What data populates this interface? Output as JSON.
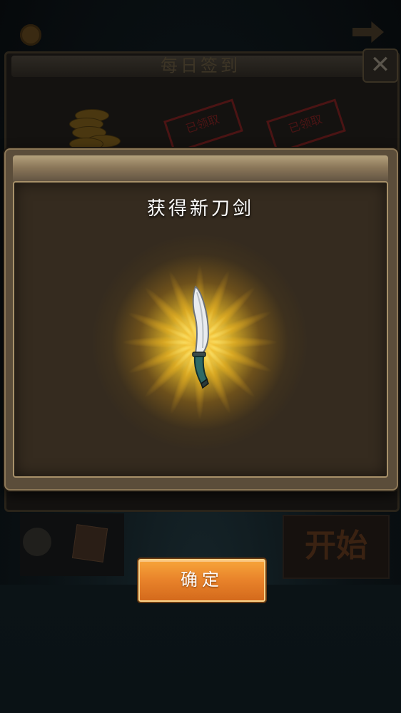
{
  "background": {
    "daily_panel_title": "每日签到",
    "stamp_text": "已领取",
    "start_button_label": "开始"
  },
  "popup": {
    "title": "获得新刀剑",
    "confirm_label": "确定",
    "reward_icon": "knife-icon"
  },
  "colors": {
    "confirm_button": "#e8822a",
    "panel_inner": "#352b1f",
    "glow": "#ffd84a"
  }
}
